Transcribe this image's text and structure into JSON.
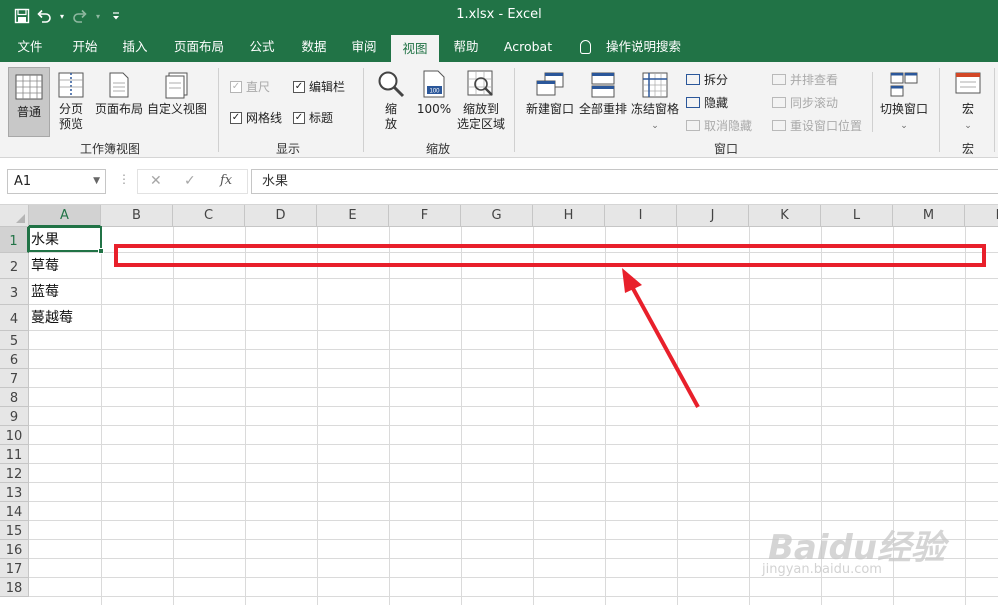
{
  "titlebar": {
    "title": "1.xlsx  -  Excel",
    "icons": [
      "save-icon",
      "undo-icon",
      "redo-icon",
      "customize-qat-icon"
    ]
  },
  "tabs": [
    {
      "label": "文件"
    },
    {
      "label": "开始"
    },
    {
      "label": "插入"
    },
    {
      "label": "页面布局"
    },
    {
      "label": "公式"
    },
    {
      "label": "数据"
    },
    {
      "label": "审阅"
    },
    {
      "label": "视图",
      "active": true
    },
    {
      "label": "帮助"
    },
    {
      "label": "Acrobat"
    }
  ],
  "tell_me": "操作说明搜索",
  "ribbon": {
    "workbook_views": {
      "label": "工作簿视图",
      "normal": "普通",
      "page_break_line1": "分页",
      "page_break_line2": "预览",
      "page_layout": "页面布局",
      "custom_views": "自定义视图"
    },
    "show": {
      "label": "显示",
      "ruler": "直尺",
      "formula_bar": "编辑栏",
      "gridlines": "网格线",
      "headings": "标题"
    },
    "zoom": {
      "label": "缩放",
      "zoom_line1": "缩",
      "zoom_line2": "放",
      "zoom_100": "100%",
      "zoom_badge": "100",
      "zoom_sel_line1": "缩放到",
      "zoom_sel_line2": "选定区域"
    },
    "window": {
      "label": "窗口",
      "new_window": "新建窗口",
      "arrange_all": "全部重排",
      "freeze_panes": "冻结窗格",
      "split": "拆分",
      "hide": "隐藏",
      "unhide": "取消隐藏",
      "side_by_side": "并排查看",
      "sync_scroll": "同步滚动",
      "reset_position": "重设窗口位置",
      "switch_windows": "切换窗口"
    },
    "macros": {
      "label": "宏",
      "macros": "宏"
    }
  },
  "formula_bar": {
    "name_box": "A1",
    "fx": "fx",
    "formula": "水果"
  },
  "grid": {
    "columns": [
      "A",
      "B",
      "C",
      "D",
      "E",
      "F",
      "G",
      "H",
      "I",
      "J",
      "K",
      "L",
      "M",
      "N"
    ],
    "rows": [
      "1",
      "2",
      "3",
      "4",
      "5",
      "6",
      "7",
      "8",
      "9",
      "10",
      "11",
      "12",
      "13",
      "14",
      "15",
      "16",
      "17",
      "18"
    ],
    "cells": [
      "水果",
      "草莓",
      "蓝莓",
      "蔓越莓"
    ],
    "selected_column": "A",
    "selected_row": "1"
  },
  "watermark": {
    "brand": "Baidu经验",
    "url": "jingyan.baidu.com"
  },
  "colors": {
    "excel_green": "#217346",
    "annotation_red": "#e8202b"
  }
}
